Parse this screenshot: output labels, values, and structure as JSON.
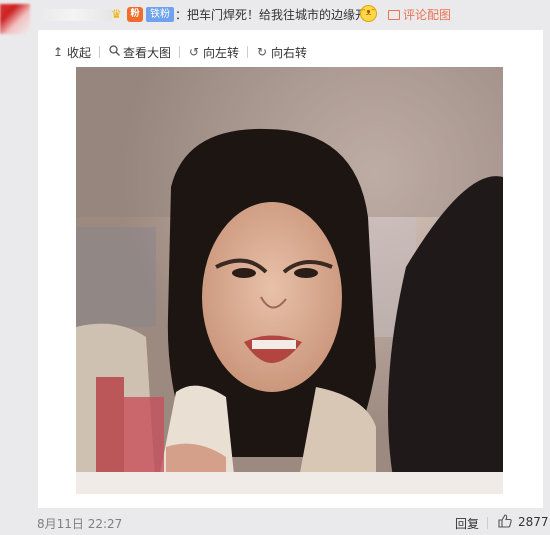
{
  "comment": {
    "fan_badge": "铁粉",
    "fans_icon_text": "粉",
    "text": "：把车门焊死！给我往城市的边缘开",
    "reply_with_image": "评论配图"
  },
  "toolbar": {
    "collapse": "收起",
    "view_large": "查看大图",
    "rotate_left": "向左转",
    "rotate_right": "向右转"
  },
  "footer": {
    "date": "8月11日 22:27",
    "reply": "回复",
    "likes": "2877"
  },
  "icons": {
    "collapse": "up-arrow-icon",
    "view_large": "search-icon",
    "rotate_left": "rotate-left-icon",
    "rotate_right": "rotate-right-icon",
    "like": "thumb-up-icon"
  },
  "colors": {
    "fan_badge": "#6ea1ee",
    "link_orange": "#eb7350",
    "background": "#eaeaec",
    "panel": "#ffffff"
  }
}
